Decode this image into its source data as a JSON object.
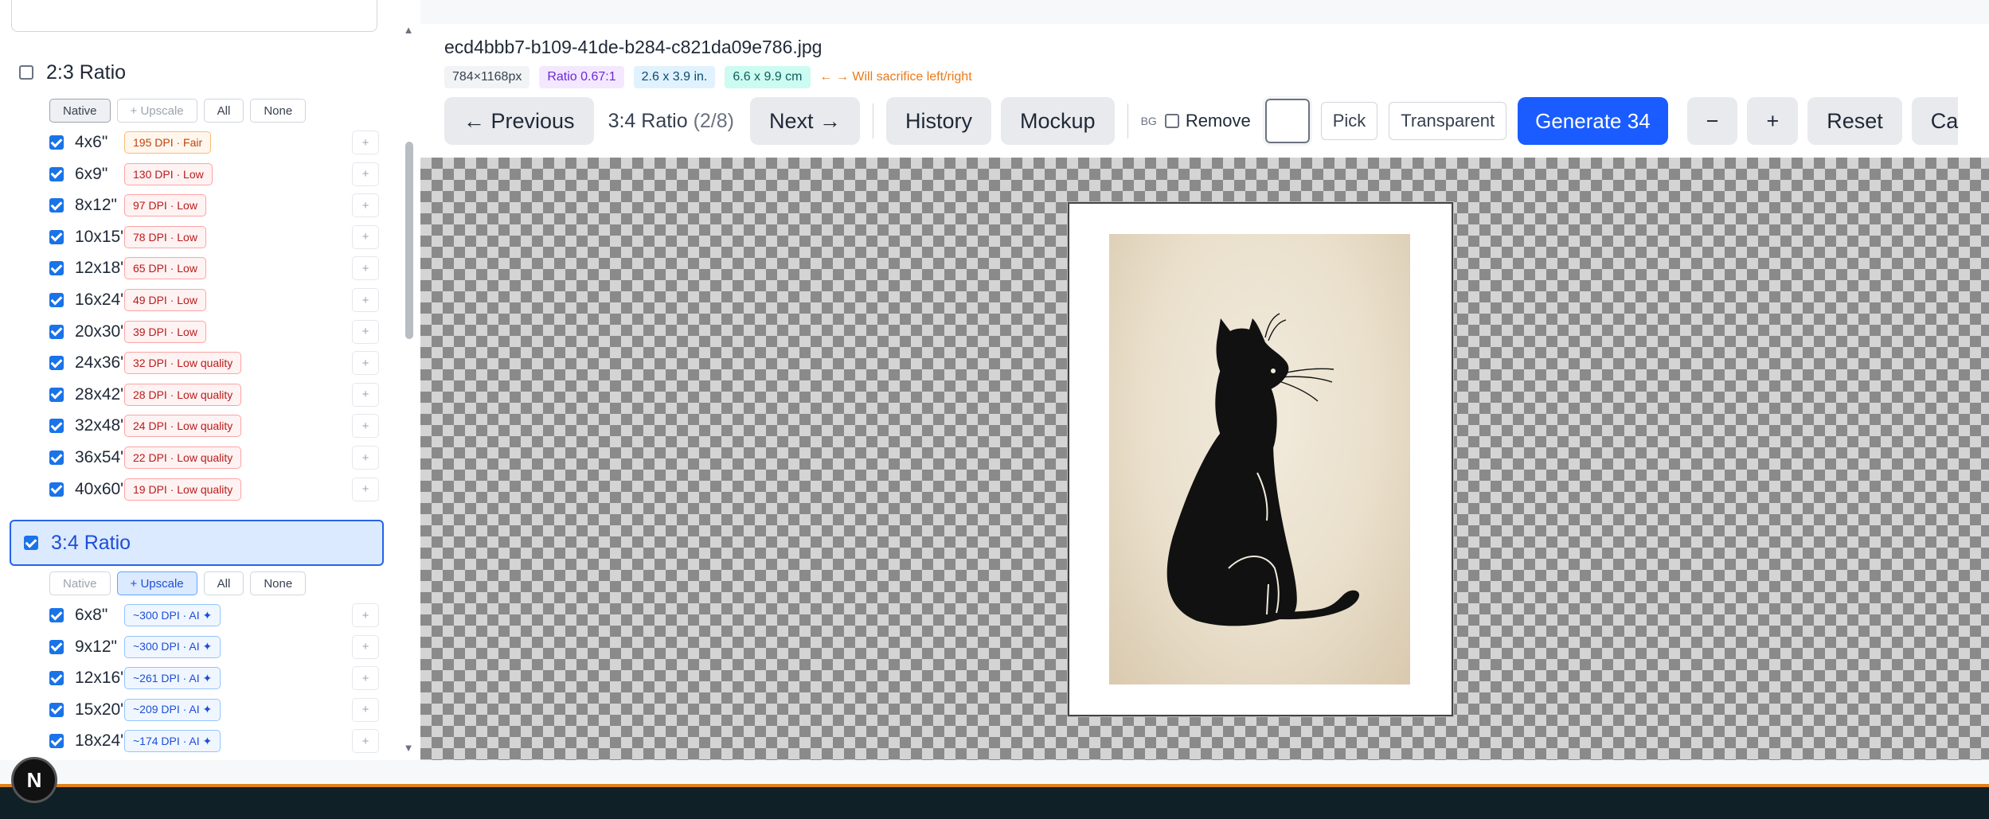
{
  "sidebar": {
    "ratio_2_3": {
      "label": "2:3 Ratio",
      "checked": false,
      "modes": [
        "Native",
        "+ Upscale",
        "All",
        "None"
      ],
      "sizes": [
        {
          "size": "4x6\"",
          "badge": "195 DPI · Fair",
          "level": "fair"
        },
        {
          "size": "6x9\"",
          "badge": "130 DPI · Low",
          "level": "low"
        },
        {
          "size": "8x12\"",
          "badge": "97 DPI · Low",
          "level": "low"
        },
        {
          "size": "10x15\"",
          "badge": "78 DPI · Low",
          "level": "low"
        },
        {
          "size": "12x18\"",
          "badge": "65 DPI · Low",
          "level": "low"
        },
        {
          "size": "16x24\"",
          "badge": "49 DPI · Low",
          "level": "low"
        },
        {
          "size": "20x30\"",
          "badge": "39 DPI · Low",
          "level": "low"
        },
        {
          "size": "24x36\"",
          "badge": "32 DPI · Low quality",
          "level": "low"
        },
        {
          "size": "28x42\"",
          "badge": "28 DPI · Low quality",
          "level": "low"
        },
        {
          "size": "32x48\"",
          "badge": "24 DPI · Low quality",
          "level": "low"
        },
        {
          "size": "36x54\"",
          "badge": "22 DPI · Low quality",
          "level": "low"
        },
        {
          "size": "40x60\"",
          "badge": "19 DPI · Low quality",
          "level": "low"
        }
      ]
    },
    "ratio_3_4": {
      "label": "3:4 Ratio",
      "checked": true,
      "modes": [
        "Native",
        "+ Upscale",
        "All",
        "None"
      ],
      "sizes": [
        {
          "size": "6x8\"",
          "badge": "~300 DPI · AI ✦",
          "level": "ai"
        },
        {
          "size": "9x12\"",
          "badge": "~300 DPI · AI ✦",
          "level": "ai"
        },
        {
          "size": "12x16\"",
          "badge": "~261 DPI · AI ✦",
          "level": "ai"
        },
        {
          "size": "15x20\"",
          "badge": "~209 DPI · AI ✦",
          "level": "ai"
        },
        {
          "size": "18x24\"",
          "badge": "~174 DPI · AI ✦",
          "level": "ai"
        }
      ]
    },
    "plus_label": "+"
  },
  "header": {
    "file_name": "ecd4bbb7-b109-41de-b284-c821da09e786.jpg",
    "dims": "784×1168px",
    "ratio": "Ratio 0.67:1",
    "inches": "2.6 x 3.9 in.",
    "cm": "6.6 x 9.9 cm",
    "warning": "← → Will sacrifice left/right"
  },
  "toolbar": {
    "previous": "← Previous",
    "current_ratio": "3:4 Ratio",
    "position": "(2/8)",
    "next": "Next →",
    "history": "History",
    "mockup": "Mockup",
    "bg": "BG",
    "remove": "Remove",
    "pick": "Pick",
    "transparent": "Transparent",
    "generate": "Generate 34",
    "minus": "−",
    "plus": "+",
    "reset": "Reset",
    "cut_off": "Ca"
  },
  "colors": {
    "accent": "#1a5cff",
    "swatch": "#ffffff",
    "footer": "#0f2026",
    "footer_border": "#e0811b"
  },
  "floating": {
    "n_label": "N"
  }
}
